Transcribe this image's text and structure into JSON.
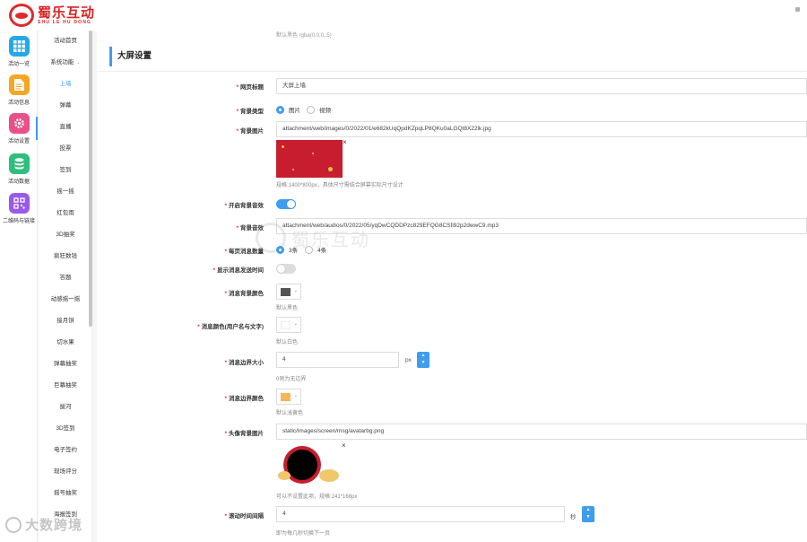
{
  "brand": {
    "name_cn": "蜀乐互动",
    "name_en": "SHU LE HU DONG",
    "color": "#d92121"
  },
  "rail": [
    {
      "label": "活动一览",
      "icon": "grid-icon",
      "color": "#26a8e8"
    },
    {
      "label": "活动信息",
      "icon": "document-icon",
      "color": "#f5a623"
    },
    {
      "label": "活动设置",
      "icon": "gear-icon",
      "color": "#e9508a"
    },
    {
      "label": "活动数据",
      "icon": "database-icon",
      "color": "#2ebf7d"
    },
    {
      "label": "二维码与链接",
      "icon": "qrcode-icon",
      "color": "#9b59e8"
    }
  ],
  "submenu": {
    "items": [
      "活动首页",
      "系统功能",
      "上墙",
      "弹幕",
      "直播",
      "投票",
      "签到",
      "摇一摇",
      "红包雨",
      "3D抽奖",
      "疯狂数钱",
      "答题",
      "动感摇一摇",
      "接月饼",
      "切水果",
      "弹幕抽奖",
      "巨幕抽奖",
      "拔河",
      "3D签到",
      "电子签约",
      "现场评分",
      "摇号抽奖",
      "海报签到"
    ],
    "active": "上墙"
  },
  "main": {
    "top_note": "默认黑色 rgba(0,0,0,.5)",
    "section_title": "大屏设置",
    "fields": {
      "page_title": {
        "label": "网页标题",
        "value": "大屏上墙"
      },
      "bg_type": {
        "label": "背景类型",
        "options": [
          "图片",
          "视频"
        ],
        "selected": "图片"
      },
      "bg_image": {
        "label": "背景图片",
        "value": "attachment/web/images/0/2022/01/e682kUqQpdKZpqLP8QKu0aLGQt8X22lk.jpg",
        "hint": "规格:1400*800px，具体尺寸需结合屏幕实际尺寸设计"
      },
      "bg_music_on": {
        "label": "开启背景音效",
        "on": true
      },
      "bg_music": {
        "label": "背景音效",
        "value": "attachment/web/audios/0/2022/05/yqDwCQDDPzc829EFQG8CSfi92p2dwwC9.mp3"
      },
      "msg_count": {
        "label": "每页消息数量",
        "options": [
          "3条",
          "4条"
        ],
        "selected": "3条"
      },
      "show_time": {
        "label": "显示消息发送时间",
        "on": false
      },
      "msg_bg_color": {
        "label": "消息背景颜色",
        "swatch": "#555555",
        "hint": "默认黑色"
      },
      "msg_color": {
        "label": "消息颜色(用户名与文字)",
        "swatch": "#ffffff",
        "hint": "默认白色"
      },
      "msg_border_size": {
        "label": "消息边界大小",
        "value": "4",
        "unit": "px",
        "hint": "0则为无边界"
      },
      "msg_border_color": {
        "label": "消息边界颜色",
        "swatch": "#f6b757",
        "hint": "默认浅黄色"
      },
      "avatar_bg": {
        "label": "头像背景图片",
        "value": "static/images/screen/msg/avatarbg.png",
        "hint": "可以不设置此项，规格:241*168px"
      },
      "scroll_interval": {
        "label": "滚动时间间隔",
        "value": "4",
        "unit": "秒",
        "hint": "即为每几秒切换下一页"
      }
    },
    "close_glyph": "×",
    "spin_up": "▲",
    "spin_down": "▼",
    "caret": "⌄",
    "required_mark": "*"
  },
  "watermark": {
    "text": "蜀乐互动",
    "corner_text": "大数跨境"
  },
  "colors": {
    "accent": "#3f9df0",
    "required": "#e33333"
  }
}
